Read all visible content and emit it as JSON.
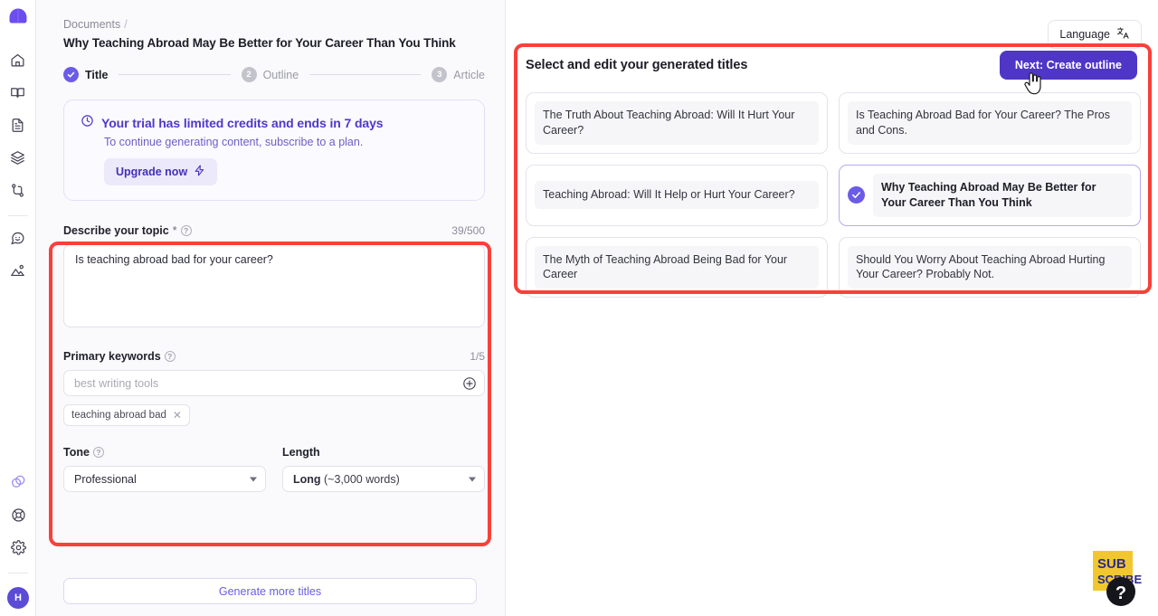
{
  "sidebar": {
    "logo_name": "app-logo",
    "items": [
      {
        "name": "home-icon",
        "label": "Home"
      },
      {
        "name": "book-icon",
        "label": "Library"
      },
      {
        "name": "document-icon",
        "label": "Documents"
      },
      {
        "name": "layers-icon",
        "label": "Projects"
      },
      {
        "name": "branch-icon",
        "label": "Workflows"
      },
      {
        "name": "chat-icon",
        "label": "Chat"
      },
      {
        "name": "image-icon",
        "label": "Images"
      }
    ],
    "bottom_items": [
      {
        "name": "rings-icon",
        "label": "Integrations"
      },
      {
        "name": "lifebuoy-icon",
        "label": "Help"
      },
      {
        "name": "gear-icon",
        "label": "Settings"
      }
    ],
    "avatar_initial": "H"
  },
  "breadcrumb": {
    "parent": "Documents",
    "separator": "/",
    "title": "Why Teaching Abroad May Be Better for Your Career Than You Think"
  },
  "steps": [
    {
      "number": "1",
      "label": "Title",
      "state": "done"
    },
    {
      "number": "2",
      "label": "Outline",
      "state": "pending"
    },
    {
      "number": "3",
      "label": "Article",
      "state": "pending"
    }
  ],
  "trial": {
    "icon": "clock-icon",
    "heading": "Your trial has limited credits and ends in 7 days",
    "subtext": "To continue generating content, subscribe to a plan.",
    "cta_label": "Upgrade now",
    "cta_icon": "lightning-icon"
  },
  "form": {
    "topic": {
      "label": "Describe your topic",
      "required_mark": "*",
      "help_icon": "question-icon",
      "counter": "39/500",
      "value": "Is teaching abroad bad for your career?"
    },
    "keywords": {
      "label": "Primary keywords",
      "help_icon": "question-icon",
      "counter": "1/5",
      "placeholder": "best writing tools",
      "value": "",
      "add_icon": "plus-circle-icon",
      "chips": [
        {
          "label": "teaching abroad bad",
          "remove_icon": "close-icon"
        }
      ]
    },
    "tone": {
      "label": "Tone",
      "help_icon": "question-icon",
      "selected": "Professional"
    },
    "length": {
      "label": "Length",
      "selected_bold": "Long",
      "selected_rest": " (~3,000 words)"
    },
    "generate_more_label": "Generate more titles"
  },
  "toolbar": {
    "language_label": "Language",
    "language_icon": "translate-icon"
  },
  "titles_panel": {
    "heading": "Select and edit your generated titles",
    "next_label": "Next: Create outline",
    "cards": [
      {
        "text": "The Truth About Teaching Abroad: Will It Hurt Your Career?",
        "selected": false
      },
      {
        "text": "Is Teaching Abroad Bad for Your Career? The Pros and Cons.",
        "selected": false
      },
      {
        "text": "Teaching Abroad: Will It Help or Hurt Your Career?",
        "selected": false
      },
      {
        "text": "Why Teaching Abroad May Be Better for Your Career Than You Think",
        "selected": true
      },
      {
        "text": "The Myth of Teaching Abroad Being Bad for Your Career",
        "selected": false
      },
      {
        "text": "Should You Worry About Teaching Abroad Hurting Your Career? Probably Not.",
        "selected": false
      }
    ]
  },
  "badge": {
    "line1": "SUB",
    "line2": "SCRIBE",
    "mark": "?"
  },
  "colors": {
    "accent": "#6b5ce7",
    "accent_dark": "#4f36c6",
    "annotation": "#f9403a",
    "panel_bg": "#fafafc",
    "badge_bg": "#f2c72e"
  }
}
